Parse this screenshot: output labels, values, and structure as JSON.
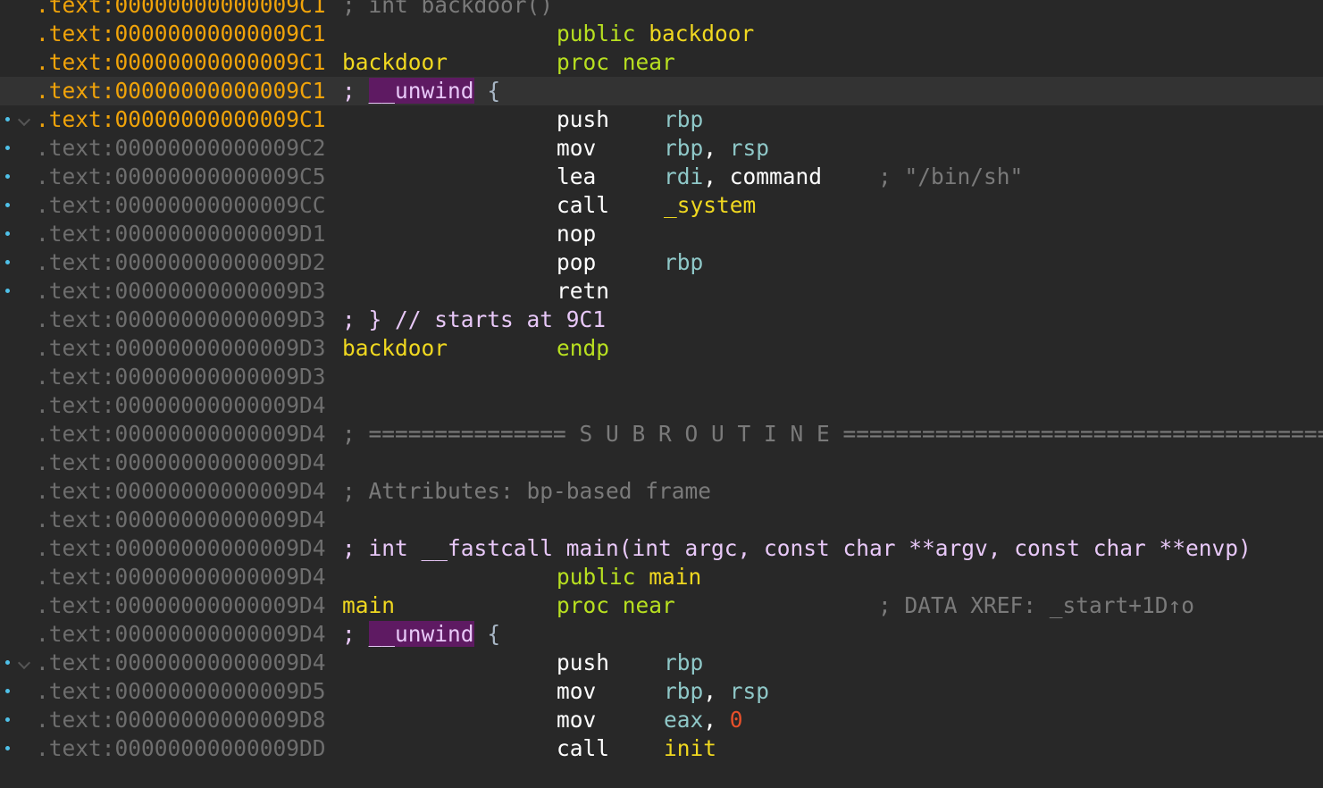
{
  "rows": [
    {
      "addr": ".text:00000000000009C1",
      "kind": "comment",
      "text": "; int backdoor()",
      "hl": true
    },
    {
      "addr": ".text:00000000000009C1",
      "kind": "directive",
      "kw": "public",
      "name": "backdoor",
      "hl": true
    },
    {
      "addr": ".text:00000000000009C1",
      "kind": "proc",
      "label": "backdoor",
      "kw": "proc",
      "arg": "near",
      "hl": true
    },
    {
      "addr": ".text:00000000000009C1",
      "kind": "unwind",
      "semi": ";",
      "kw": "__unwind",
      "brace": "{",
      "hl": true,
      "cursor": true
    },
    {
      "addr": ".text:00000000000009C1",
      "kind": "instr",
      "mn": "push",
      "ops": [
        {
          "t": "reg",
          "v": "rbp"
        }
      ],
      "hl": true,
      "dot": true,
      "fold": true
    },
    {
      "addr": ".text:00000000000009C2",
      "kind": "instr",
      "mn": "mov",
      "ops": [
        {
          "t": "reg",
          "v": "rbp"
        },
        {
          "t": "punc",
          "v": ", "
        },
        {
          "t": "reg",
          "v": "rsp"
        }
      ],
      "dot": true
    },
    {
      "addr": ".text:00000000000009C5",
      "kind": "instr",
      "mn": "lea",
      "ops": [
        {
          "t": "reg",
          "v": "rdi"
        },
        {
          "t": "punc",
          "v": ", "
        },
        {
          "t": "sym",
          "v": "command"
        }
      ],
      "comment": "; \"/bin/sh\"",
      "dot": true
    },
    {
      "addr": ".text:00000000000009CC",
      "kind": "instr",
      "mn": "call",
      "ops": [
        {
          "t": "fn",
          "v": "_system"
        }
      ],
      "dot": true
    },
    {
      "addr": ".text:00000000000009D1",
      "kind": "instr",
      "mn": "nop",
      "ops": [],
      "dot": true
    },
    {
      "addr": ".text:00000000000009D2",
      "kind": "instr",
      "mn": "pop",
      "ops": [
        {
          "t": "reg",
          "v": "rbp"
        }
      ],
      "dot": true
    },
    {
      "addr": ".text:00000000000009D3",
      "kind": "instr",
      "mn": "retn",
      "ops": [],
      "dot": true
    },
    {
      "addr": ".text:00000000000009D3",
      "kind": "comment",
      "text": "; } // starts at 9C1",
      "style": "decl"
    },
    {
      "addr": ".text:00000000000009D3",
      "kind": "proc",
      "label": "backdoor",
      "kw": "endp",
      "arg": ""
    },
    {
      "addr": ".text:00000000000009D3",
      "kind": "empty"
    },
    {
      "addr": ".text:00000000000009D4",
      "kind": "empty"
    },
    {
      "addr": ".text:00000000000009D4",
      "kind": "comment",
      "text": "; =============== S U B R O U T I N E =======================================",
      "style": "sep"
    },
    {
      "addr": ".text:00000000000009D4",
      "kind": "empty"
    },
    {
      "addr": ".text:00000000000009D4",
      "kind": "comment",
      "text": "; Attributes: bp-based frame"
    },
    {
      "addr": ".text:00000000000009D4",
      "kind": "empty"
    },
    {
      "addr": ".text:00000000000009D4",
      "kind": "comment",
      "text": "; int __fastcall main(int argc, const char **argv, const char **envp)",
      "style": "decl"
    },
    {
      "addr": ".text:00000000000009D4",
      "kind": "directive",
      "kw": "public",
      "name": "main"
    },
    {
      "addr": ".text:00000000000009D4",
      "kind": "proc",
      "label": "main",
      "kw": "proc",
      "arg": "near",
      "comment": "; DATA XREF: _start+1D↑o"
    },
    {
      "addr": ".text:00000000000009D4",
      "kind": "unwind",
      "semi": ";",
      "kw": "__unwind",
      "brace": "{"
    },
    {
      "addr": ".text:00000000000009D4",
      "kind": "instr",
      "mn": "push",
      "ops": [
        {
          "t": "reg",
          "v": "rbp"
        }
      ],
      "dot": true,
      "fold": true
    },
    {
      "addr": ".text:00000000000009D5",
      "kind": "instr",
      "mn": "mov",
      "ops": [
        {
          "t": "reg",
          "v": "rbp"
        },
        {
          "t": "punc",
          "v": ", "
        },
        {
          "t": "reg",
          "v": "rsp"
        }
      ],
      "dot": true
    },
    {
      "addr": ".text:00000000000009D8",
      "kind": "instr",
      "mn": "mov",
      "ops": [
        {
          "t": "reg",
          "v": "eax"
        },
        {
          "t": "punc",
          "v": ", "
        },
        {
          "t": "num",
          "v": "0"
        }
      ],
      "dot": true
    },
    {
      "addr": ".text:00000000000009DD",
      "kind": "instr",
      "mn": "call",
      "ops": [
        {
          "t": "fn",
          "v": "init"
        }
      ],
      "dot": true
    }
  ]
}
